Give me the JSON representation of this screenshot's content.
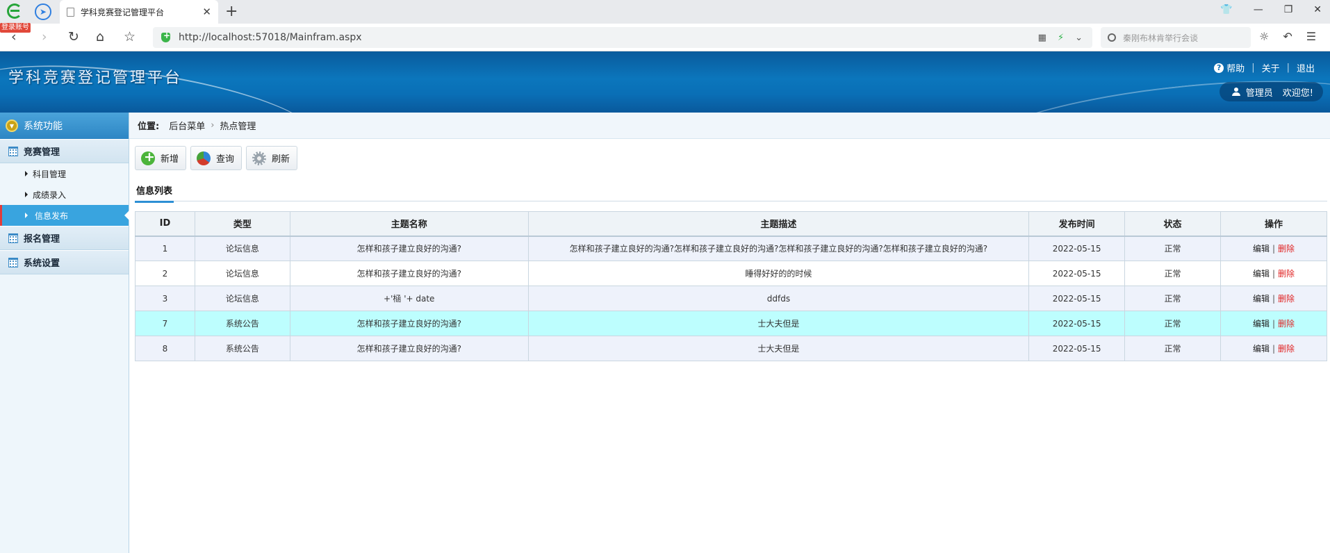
{
  "browser": {
    "login_badge": "登录账号",
    "tab_title": "学科竞赛登记管理平台",
    "url": "http://localhost:57018/Mainfram.aspx",
    "search_placeholder": "秦刚布林肯举行会谈"
  },
  "header": {
    "title": "学科竞赛登记管理平台",
    "links": {
      "help": "帮助",
      "about": "关于",
      "logout": "退出"
    },
    "user_role": "管理员",
    "welcome": "欢迎您!"
  },
  "sidebar": {
    "heading": "系统功能",
    "groups": [
      {
        "label": "竞赛管理",
        "items": [
          {
            "label": "科目管理"
          },
          {
            "label": "成绩录入"
          },
          {
            "label": "信息发布",
            "active": true
          }
        ]
      },
      {
        "label": "报名管理"
      },
      {
        "label": "系统设置"
      }
    ]
  },
  "breadcrumb": {
    "prefix": "位置:",
    "items": [
      "后台菜单",
      "热点管理"
    ]
  },
  "toolbar": {
    "add": "新增",
    "query": "查询",
    "refresh": "刷新"
  },
  "tab_label": "信息列表",
  "table": {
    "columns": [
      "ID",
      "类型",
      "主题名称",
      "主题描述",
      "发布时间",
      "状态",
      "操作"
    ],
    "rows": [
      {
        "id": "1",
        "type": "论坛信息",
        "name": "怎样和孩子建立良好的沟通?",
        "desc": "怎样和孩子建立良好的沟通?怎样和孩子建立良好的沟通?怎样和孩子建立良好的沟通?怎样和孩子建立良好的沟通?",
        "date": "2022-05-15",
        "status": "正常"
      },
      {
        "id": "2",
        "type": "论坛信息",
        "name": "怎样和孩子建立良好的沟通?",
        "desc": "睡得好好的的时候",
        "date": "2022-05-15",
        "status": "正常"
      },
      {
        "id": "3",
        "type": "论坛信息",
        "name": "+'㮀 '+ date",
        "desc": "ddfds",
        "date": "2022-05-15",
        "status": "正常"
      },
      {
        "id": "7",
        "type": "系统公告",
        "name": "怎样和孩子建立良好的沟通?",
        "desc": "士大夫但是",
        "date": "2022-05-15",
        "status": "正常"
      },
      {
        "id": "8",
        "type": "系统公告",
        "name": "怎样和孩子建立良好的沟通?",
        "desc": "士大夫但是",
        "date": "2022-05-15",
        "status": "正常"
      }
    ],
    "actions": {
      "edit": "编辑",
      "separator": "|",
      "delete": "删除"
    }
  }
}
